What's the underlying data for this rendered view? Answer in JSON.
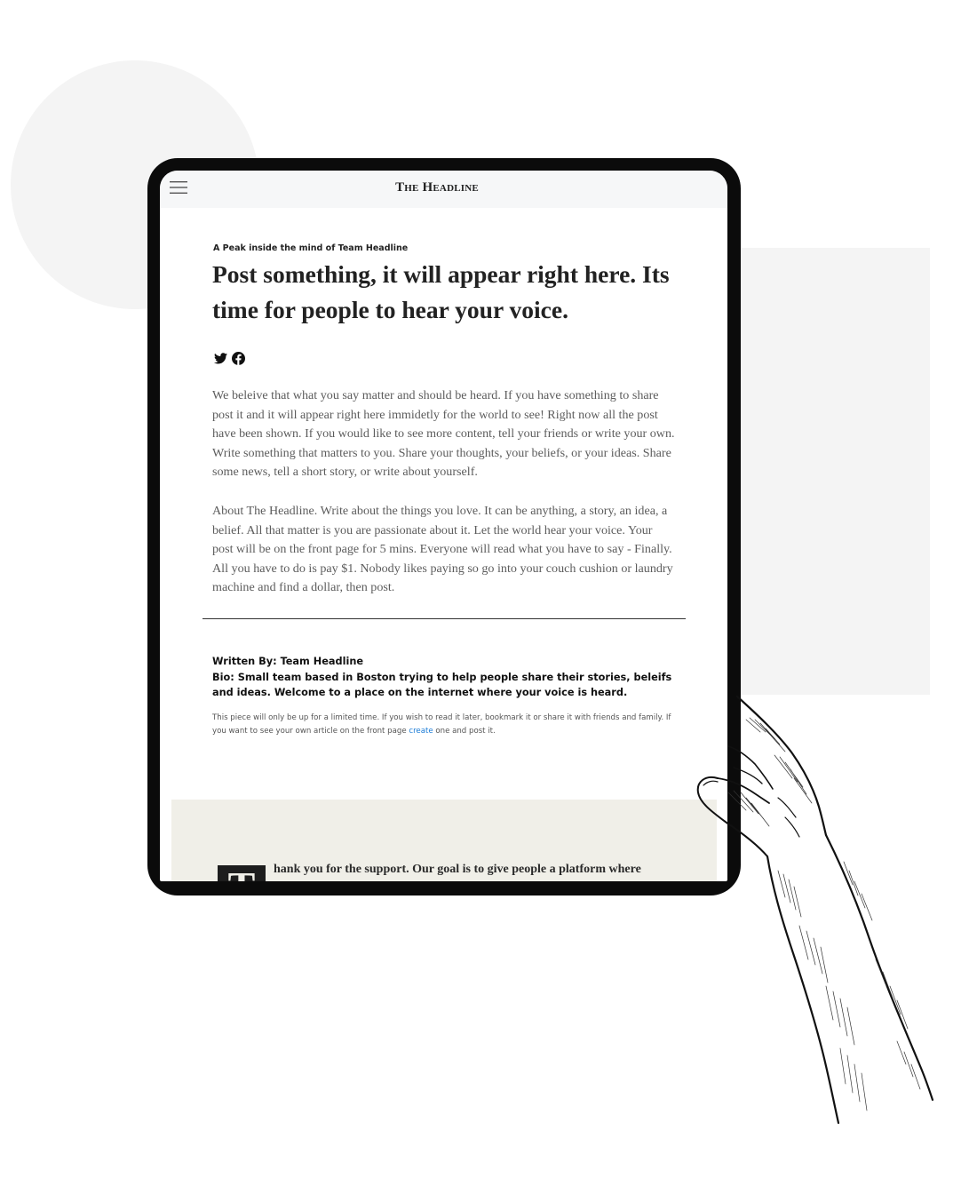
{
  "site": {
    "brand": "The Headline"
  },
  "article": {
    "kicker": "A Peak inside the mind of Team Headline",
    "title": "Post something, it will appear right here. Its time for people to hear your voice.",
    "paragraphs": [
      "We beleive that what you say matter and should be heard. If you have something to share post it and it will appear right here immidetly for the world to see! Right now all the post have been shown. If you would like to see more content, tell your friends or write your own. Write something that matters to you. Share your thoughts, your beliefs, or your ideas. Share some news, tell a short story, or write about yourself.",
      "About The Headline. Write about the things you love. It can be anything, a story, an idea, a belief. All that matter is you are passionate about it. Let the world hear your voice. Your post will be on the front page for 5 mins. Everyone will read what you have to say - Finally. All you have to do is pay $1. Nobody likes paying so go into your couch cushion or laundry machine and find a dollar, then post."
    ],
    "share_icons": [
      "twitter-icon",
      "facebook-icon"
    ]
  },
  "author": {
    "written_by": "Written By: Team Headline",
    "bio": "Bio: Small team based in Boston trying to help people share their stories, beleifs and ideas. Welcome to a place on the internet where your voice is heard."
  },
  "note": {
    "text_before": "This piece will only be up for a limited time. If you wish to read it later, bookmark it or share it with friends and family. If you want to see your own article on the front page ",
    "link": "create",
    "text_after": " one and post it."
  },
  "footer": {
    "dropcap": "T",
    "text": "hank you for the support. Our goal is to give people a platform where"
  },
  "colors": {
    "accent_link": "#1a7bd6",
    "footer_band": "#f0efe8",
    "device_frame": "#0b0b0b"
  }
}
